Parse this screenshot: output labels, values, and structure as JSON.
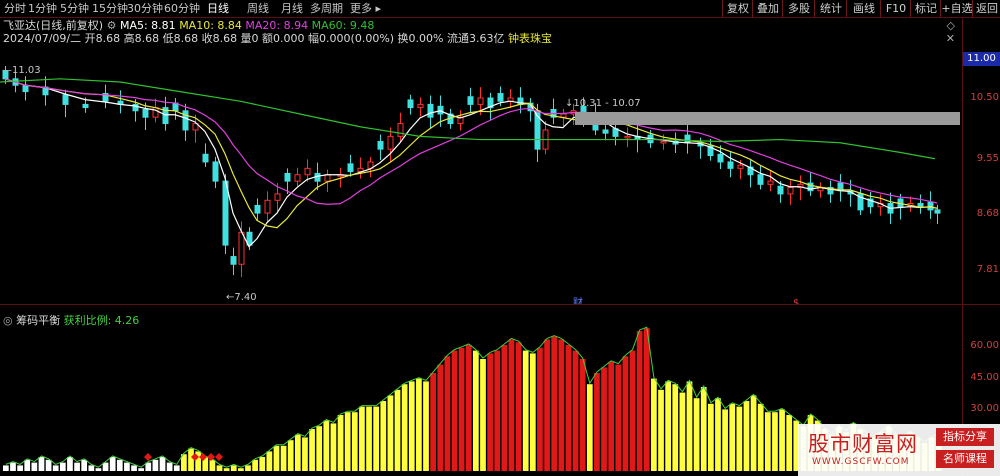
{
  "toolbar": {
    "timeframes": [
      "分时",
      "1分钟",
      "5分钟",
      "15分钟",
      "30分钟",
      "60分钟",
      "日线",
      "周线",
      "月线",
      "多周期",
      "更多"
    ],
    "active_timeframe": "日线",
    "right_buttons": [
      "复权",
      "叠加",
      "多股",
      "统计",
      "画线",
      "F10",
      "标记",
      "+自选",
      "返回"
    ]
  },
  "main": {
    "title": "飞亚达(日线,前复权)",
    "ma5": "MA5: 8.81",
    "ma10": "MA10: 8.84",
    "ma20": "MA20: 8.94",
    "ma60": "MA60: 9.48",
    "detail": "2024/07/09/二 开8.68 高8.68 低8.68 收8.68 量0 额0.000 幅0.000(0.00%) 换0.00% 流通3.63亿",
    "concept": "钟表珠宝",
    "high_marker": "11.03",
    "low_marker": "←7.40",
    "range_marker": "10.31 - 10.07",
    "price_tag": "11.00",
    "y_ticks": [
      "10.50",
      "9.55",
      "8.68",
      "7.81"
    ],
    "events": [
      "财",
      "$"
    ],
    "colors": {
      "up": "#ff3030",
      "down": "#40e0e0",
      "ma5": "#ffffff",
      "ma10": "#e8e83a",
      "ma20": "#e040e0",
      "ma60": "#30c030"
    }
  },
  "indicator": {
    "title": "筹码平衡",
    "ratio": "获利比例: 4.26",
    "y_ticks": [
      "60.00",
      "45.00",
      "30.00"
    ],
    "colors": {
      "red": "#e01818",
      "yellow": "#ffff40",
      "white": "#ffffff"
    }
  },
  "chart_data": {
    "type": "bar",
    "title": "筹码平衡",
    "ylabel": "",
    "ylim": [
      15,
      70
    ],
    "values": [
      17,
      18,
      17,
      19,
      18,
      20,
      19,
      17,
      18,
      20,
      18,
      19,
      17,
      16,
      18,
      20,
      19,
      18,
      17,
      16,
      18,
      19,
      20,
      18,
      17,
      21,
      23,
      22,
      20,
      19,
      17,
      16,
      17,
      16,
      17,
      19,
      20,
      22,
      24,
      24,
      26,
      28,
      27,
      30,
      31,
      33,
      32,
      35,
      36,
      36,
      38,
      38,
      38,
      40,
      42,
      44,
      46,
      47,
      48,
      47,
      50,
      53,
      56,
      58,
      59,
      60,
      58,
      55,
      57,
      58,
      60,
      62,
      61,
      58,
      57,
      59,
      62,
      63,
      62,
      60,
      58,
      55,
      46,
      50,
      52,
      54,
      53,
      56,
      58,
      65,
      66,
      48,
      44,
      47,
      46,
      43,
      47,
      41,
      45,
      39,
      41,
      37,
      39,
      38,
      40,
      42,
      39,
      36,
      36,
      37,
      35,
      33,
      31,
      35,
      33,
      30,
      28,
      31,
      29,
      32,
      30,
      28,
      27,
      29,
      31,
      28,
      26,
      29,
      27,
      25,
      27,
      28
    ],
    "color_class": [
      "w",
      "w",
      "w",
      "w",
      "w",
      "w",
      "w",
      "w",
      "w",
      "w",
      "w",
      "w",
      "w",
      "w",
      "w",
      "w",
      "w",
      "w",
      "w",
      "w",
      "w",
      "w",
      "w",
      "w",
      "w",
      "y",
      "y",
      "y",
      "y",
      "y",
      "y",
      "y",
      "y",
      "y",
      "y",
      "y",
      "y",
      "y",
      "y",
      "y",
      "y",
      "y",
      "y",
      "y",
      "y",
      "y",
      "y",
      "y",
      "y",
      "y",
      "y",
      "y",
      "y",
      "y",
      "y",
      "y",
      "y",
      "y",
      "y",
      "y",
      "r",
      "r",
      "r",
      "r",
      "r",
      "r",
      "y",
      "y",
      "r",
      "r",
      "r",
      "r",
      "r",
      "y",
      "y",
      "r",
      "r",
      "r",
      "r",
      "r",
      "r",
      "r",
      "y",
      "r",
      "r",
      "r",
      "r",
      "r",
      "r",
      "r",
      "r",
      "y",
      "y",
      "y",
      "y",
      "y",
      "y",
      "y",
      "y",
      "y",
      "y",
      "y",
      "y",
      "y",
      "y",
      "y",
      "y",
      "y",
      "y",
      "y",
      "y",
      "y",
      "y",
      "y",
      "y",
      "y",
      "y",
      "y",
      "y",
      "y",
      "y",
      "y",
      "y",
      "y",
      "y",
      "y",
      "y",
      "y",
      "y",
      "y",
      "y",
      "y"
    ]
  },
  "watermark": {
    "site": "股市财富网",
    "url": "WWW.GSCFW.COM",
    "tag1": "指标分享",
    "tag2": "名师课程"
  }
}
